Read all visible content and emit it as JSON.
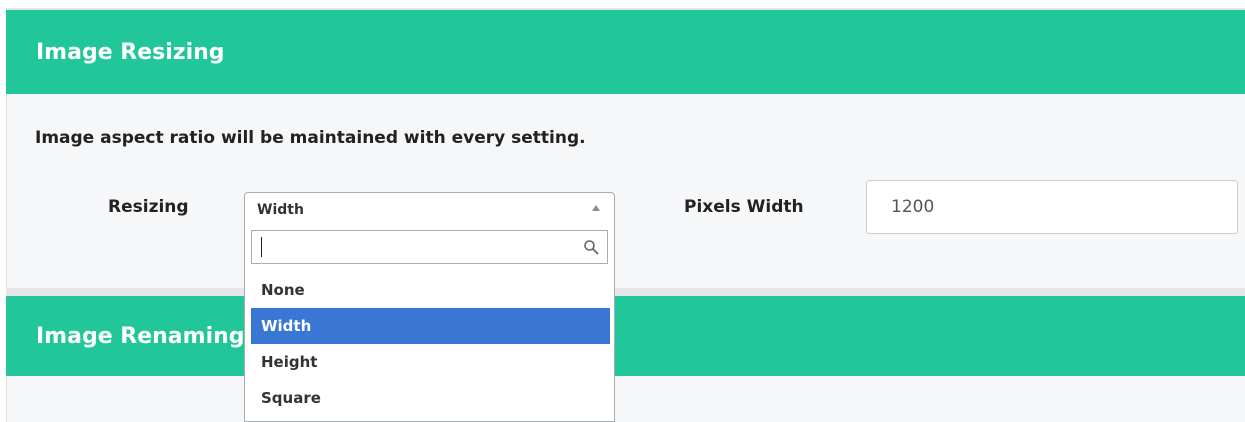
{
  "resizing_panel": {
    "title": "Image Resizing",
    "note": "Image aspect ratio will be maintained with every setting.",
    "resizing_label": "Resizing",
    "resizing_select": {
      "selected": "Width",
      "search_value": "",
      "options": [
        {
          "label": "None",
          "selected": false
        },
        {
          "label": "Width",
          "selected": true
        },
        {
          "label": "Height",
          "selected": false
        },
        {
          "label": "Square",
          "selected": false
        }
      ]
    },
    "pixels_label": "Pixels Width",
    "pixels_value": "1200"
  },
  "renaming_panel": {
    "title": "Image Renaming"
  },
  "colors": {
    "header_green": "#21c798",
    "selected_blue": "#3a76d4",
    "body_bg": "#f6f7f8"
  },
  "icons": {
    "select_arrow": "caret-up-icon",
    "search": "search-icon"
  }
}
